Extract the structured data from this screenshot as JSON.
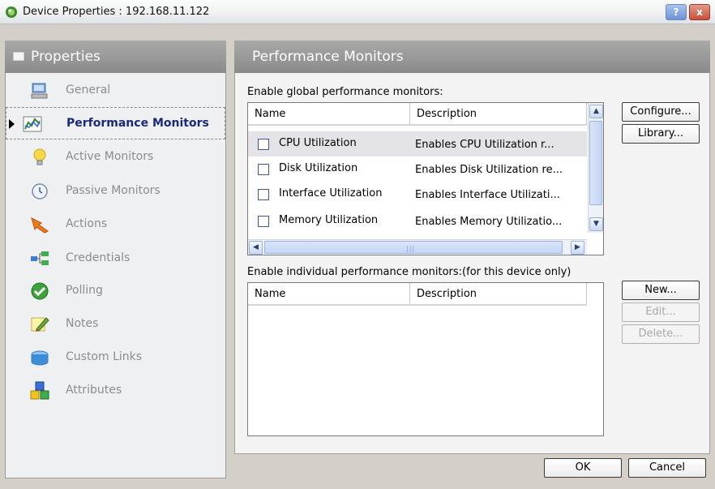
{
  "window": {
    "title": "Device Properties : 192.168.11.122",
    "help_btn": "?",
    "close_btn": "x"
  },
  "sidebar": {
    "header": "Properties",
    "items": [
      {
        "label": "General",
        "icon": "computer-icon"
      },
      {
        "label": "Performance Monitors",
        "icon": "chart-icon",
        "active": true
      },
      {
        "label": "Active Monitors",
        "icon": "lightbulb-icon"
      },
      {
        "label": "Passive Monitors",
        "icon": "clock-icon"
      },
      {
        "label": "Actions",
        "icon": "arrow-icon"
      },
      {
        "label": "Credentials",
        "icon": "network-icon"
      },
      {
        "label": "Polling",
        "icon": "checkmark-icon"
      },
      {
        "label": "Notes",
        "icon": "pencil-icon"
      },
      {
        "label": "Custom Links",
        "icon": "link-icon"
      },
      {
        "label": "Attributes",
        "icon": "blocks-icon"
      }
    ]
  },
  "main": {
    "header": "Performance Monitors",
    "global_label": "Enable global performance monitors:",
    "individual_label": "Enable individual performance monitors:(for this device only)",
    "columns": {
      "name": "Name",
      "description": "Description"
    },
    "global_rows": [
      {
        "name": "CPU Utilization",
        "description": "Enables CPU Utilization r...",
        "checked": false
      },
      {
        "name": "Disk Utilization",
        "description": "Enables Disk Utilization re...",
        "checked": false
      },
      {
        "name": "Interface Utilization",
        "description": "Enables Interface Utilizati...",
        "checked": false
      },
      {
        "name": "Memory Utilization",
        "description": "Enables Memory Utilizatio...",
        "checked": false
      }
    ],
    "buttons": {
      "configure": "Configure...",
      "library": "Library...",
      "new": "New...",
      "edit": "Edit...",
      "delete": "Delete..."
    }
  },
  "footer": {
    "ok": "OK",
    "cancel": "Cancel"
  }
}
